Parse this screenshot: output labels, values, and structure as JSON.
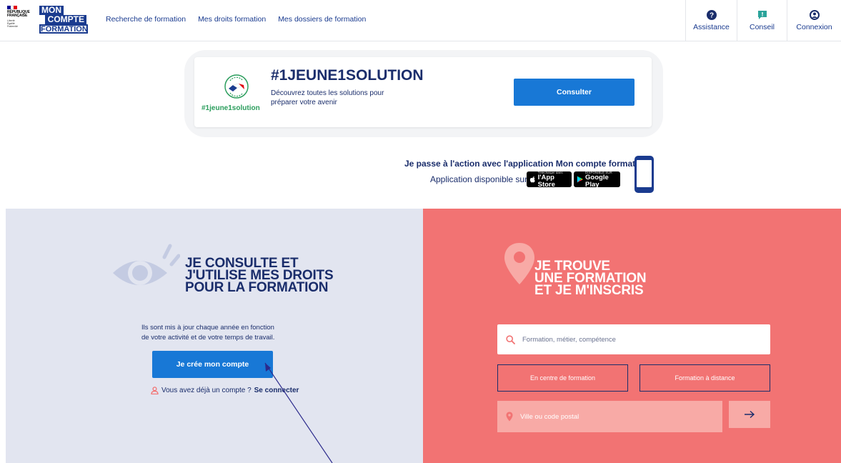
{
  "header": {
    "gov_logo": {
      "line1": "RÉPUBLIQUE",
      "line2": "FRANÇAISE",
      "motto": [
        "Liberté",
        "Égalité",
        "Fraternité"
      ],
      "flag_colors": [
        "#000091",
        "#ffffff",
        "#e1000f"
      ]
    },
    "brand_logo": {
      "line1": "MON",
      "line2": "COMPTE",
      "line3": "FORMATION"
    },
    "nav": [
      "Recherche de formation",
      "Mes droits formation",
      "Mes dossiers de formation"
    ],
    "actions": [
      {
        "label": "Assistance",
        "icon": "question-circle-icon"
      },
      {
        "label": "Conseil",
        "icon": "speech-bubble-icon"
      },
      {
        "label": "Connexion",
        "icon": "user-circle-icon"
      }
    ]
  },
  "banner": {
    "badge_label": "#1jeune1solution",
    "badge_icon": "france-relance-icon",
    "title": "#1JEUNE1SOLUTION",
    "text": "Découvrez toutes les solutions pour préparer votre avenir",
    "button": "Consulter"
  },
  "app_promo": {
    "line1": "Je passe à l'action avec l'application Mon compte formation !",
    "line2": "Application disponible sur",
    "app_store": {
      "small": "Télécharger dans",
      "big": "l'App Store",
      "icon": "apple-icon"
    },
    "google_play": {
      "small": "DISPONIBLE SUR",
      "big": "Google Play",
      "icon": "google-play-icon"
    },
    "phone_icon": "smartphone-icon"
  },
  "left_panel": {
    "icon": "eye-icon",
    "title": [
      "JE CONSULTE ET",
      "J'UTILISE MES DROITS",
      "POUR LA FORMATION"
    ],
    "description": [
      "Ils sont mis à jour chaque année en fonction",
      "de votre activité et de votre temps de travail."
    ],
    "create_button": "Je crée mon compte",
    "login_prefix": "Vous avez déjà un compte ?",
    "login_link": "Se connecter"
  },
  "right_panel": {
    "icon": "map-pin-icon",
    "title": [
      "JE TROUVE",
      "UNE FORMATION",
      "ET JE M'INSCRIS"
    ],
    "search_placeholder": "Formation, métier, compétence",
    "mode_buttons": [
      "En centre de formation",
      "Formation à distance"
    ],
    "city_placeholder": "Ville ou code postal",
    "go_icon": "arrow-right-icon"
  },
  "colors": {
    "navy": "#1a2d6b",
    "brand_blue": "#1a3b8f",
    "button_blue": "#1878d6",
    "left_bg": "#e2e5f0",
    "right_bg": "#f27373",
    "green": "#2a9d5c",
    "annotation_arrow": "#2b2a8c"
  }
}
